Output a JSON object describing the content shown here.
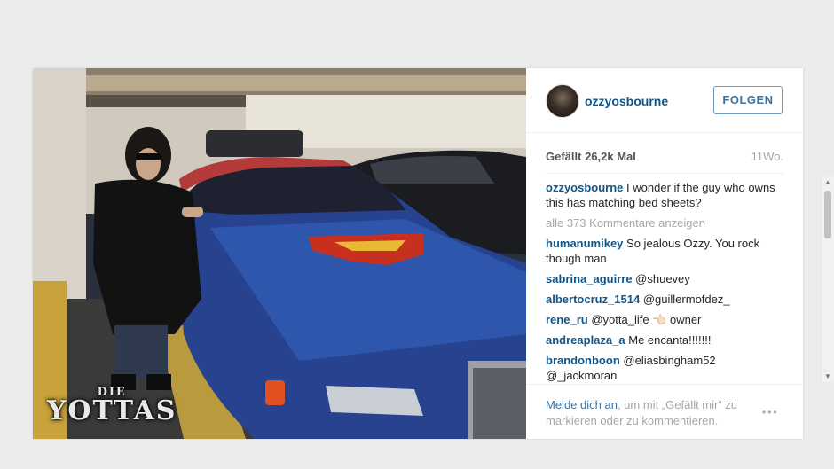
{
  "post": {
    "username": "ozzyosbourne",
    "follow_label": "FOLGEN",
    "likes": "Gefällt 26,2k Mal",
    "age": "11Wo."
  },
  "comments": [
    {
      "user": "ozzyosbourne",
      "text": "I wonder if the guy who owns this has matching bed sheets?"
    },
    {
      "user": "humanumikey",
      "text": "So jealous Ozzy. You rock though man"
    },
    {
      "user": "sabrina_aguirre",
      "text": "@shuevey"
    },
    {
      "user": "albertocruz_1514",
      "text": "@guillermofdez_"
    },
    {
      "user": "rene_ru",
      "text": "@yotta_life 👈🏻 owner"
    },
    {
      "user": "andreaplaza_a",
      "text": "Me encanta!!!!!!!"
    },
    {
      "user": "brandonboon",
      "text": "@eliasbingham52 @_jackmoran"
    }
  ],
  "more_comments": "alle 373 Kommentare anzeigen",
  "footer": {
    "login_link": "Melde dich an",
    "login_text": ", um mit „Gefällt mir“ zu markieren oder zu kommentieren.",
    "more_icon": "ellipsis-icon"
  },
  "watermark": {
    "small": "DIE",
    "big": "YOTTAS"
  }
}
